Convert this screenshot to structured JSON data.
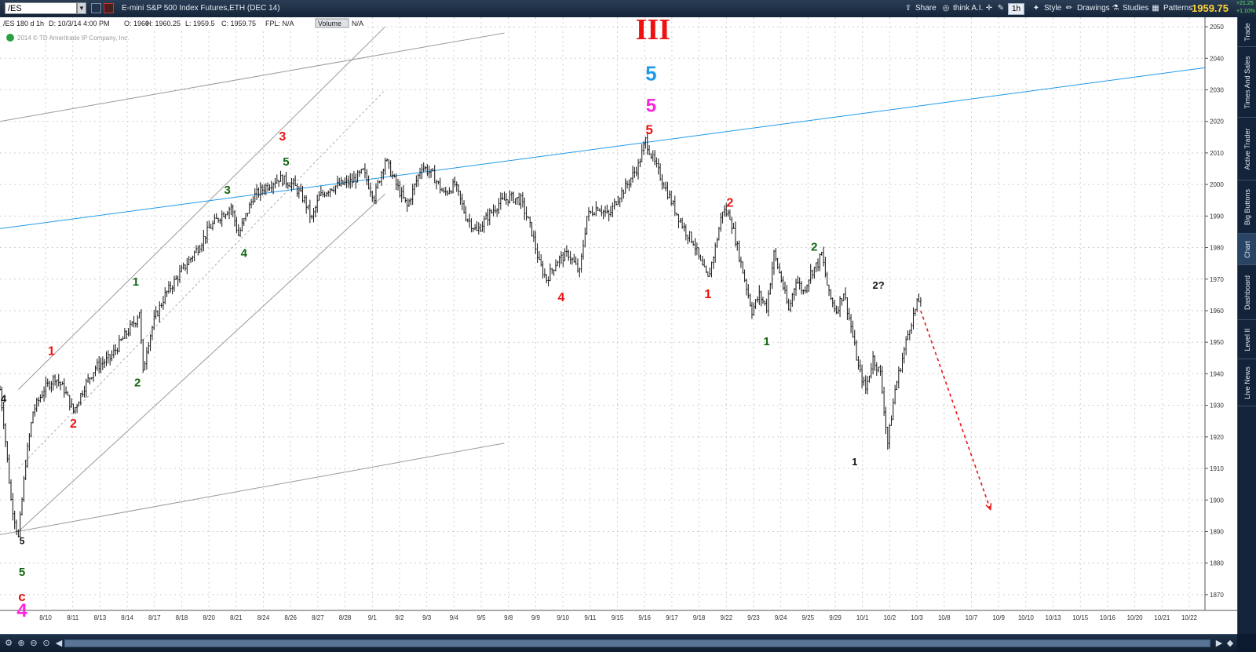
{
  "toolbar": {
    "symbol": "/ES",
    "description": "E-mini S&P 500 Index Futures,ETH (DEC 14)",
    "share": "Share",
    "thinkai": "think A.I.",
    "timeframe": "1h",
    "style": "Style",
    "drawings": "Drawings",
    "studies": "Studies",
    "patterns": "Patterns",
    "last_price": "1959.75",
    "change": "+21.25",
    "change_pct": "+1.10%"
  },
  "side_tabs": [
    "Trade",
    "Times And Sales",
    "Active Trader",
    "Big Buttons",
    "Chart",
    "Dashboard",
    "Level II",
    "Live News"
  ],
  "colors": {
    "red": "#ee1111",
    "green": "#116611",
    "magenta": "#ff22dd",
    "blue": "#1f9ae8",
    "black": "#111111",
    "grey": "#9a9a9a"
  },
  "chart_data": {
    "type": "candlestick",
    "symbol_header": "/ES 180 d 1h",
    "ohlc_header": {
      "date": "D: 10/3/14 4:00 PM",
      "open": "O: 1960",
      "high": "H: 1960.25",
      "low": "L: 1959.5",
      "close": "C: 1959.75",
      "fpl": "FPL: N/A",
      "volume_label": "Volume",
      "volume": "N/A"
    },
    "copyright": "2014 © TD Ameritrade IP Company, Inc.",
    "ylim": [
      1865,
      2053
    ],
    "y_ticks": [
      2050,
      2040,
      2030,
      2020,
      2010,
      2000,
      1990,
      1980,
      1970,
      1960,
      1950,
      1940,
      1930,
      1920,
      1910,
      1900,
      1890,
      1880,
      1870
    ],
    "x_ticks": [
      "8/10",
      "8/11",
      "8/13",
      "8/14",
      "8/17",
      "8/18",
      "8/20",
      "8/21",
      "8/24",
      "8/26",
      "8/27",
      "8/28",
      "9/1",
      "9/2",
      "9/3",
      "9/4",
      "9/5",
      "9/8",
      "9/9",
      "9/10",
      "9/11",
      "9/15",
      "9/16",
      "9/17",
      "9/18",
      "9/22",
      "9/23",
      "9/24",
      "9/25",
      "9/29",
      "10/1",
      "10/2",
      "10/3",
      "10/8",
      "10/7",
      "10/9",
      "10/10",
      "10/13",
      "10/15",
      "10/16",
      "10/20",
      "10/21",
      "10/22"
    ],
    "price_path": [
      [
        0,
        1935
      ],
      [
        2,
        1925
      ],
      [
        6,
        1900
      ],
      [
        10,
        1888
      ],
      [
        14,
        1912
      ],
      [
        18,
        1928
      ],
      [
        24,
        1935
      ],
      [
        30,
        1939
      ],
      [
        35,
        1935
      ],
      [
        40,
        1928
      ],
      [
        46,
        1936
      ],
      [
        52,
        1942
      ],
      [
        60,
        1945
      ],
      [
        68,
        1952
      ],
      [
        74,
        1957
      ],
      [
        76,
        1960
      ],
      [
        78,
        1940
      ],
      [
        80,
        1948
      ],
      [
        84,
        1957
      ],
      [
        90,
        1965
      ],
      [
        96,
        1970
      ],
      [
        102,
        1975
      ],
      [
        108,
        1980
      ],
      [
        114,
        1986
      ],
      [
        120,
        1990
      ],
      [
        126,
        1993
      ],
      [
        130,
        1984
      ],
      [
        134,
        1990
      ],
      [
        138,
        1996
      ],
      [
        144,
        1999
      ],
      [
        152,
        2002
      ],
      [
        160,
        2000
      ],
      [
        166,
        1995
      ],
      [
        170,
        1989
      ],
      [
        174,
        1996
      ],
      [
        180,
        1999
      ],
      [
        186,
        2000
      ],
      [
        192,
        2001
      ],
      [
        198,
        2004
      ],
      [
        204,
        1996
      ],
      [
        210,
        2008
      ],
      [
        216,
        2000
      ],
      [
        222,
        1993
      ],
      [
        230,
        2006
      ],
      [
        236,
        2003
      ],
      [
        242,
        1997
      ],
      [
        248,
        2000
      ],
      [
        254,
        1990
      ],
      [
        260,
        1985
      ],
      [
        266,
        1990
      ],
      [
        272,
        1994
      ],
      [
        278,
        1996
      ],
      [
        284,
        1995
      ],
      [
        290,
        1985
      ],
      [
        294,
        1975
      ],
      [
        298,
        1970
      ],
      [
        304,
        1976
      ],
      [
        310,
        1978
      ],
      [
        316,
        1972
      ],
      [
        320,
        1990
      ],
      [
        326,
        1993
      ],
      [
        332,
        1990
      ],
      [
        336,
        1995
      ],
      [
        342,
        2000
      ],
      [
        348,
        2006
      ],
      [
        352,
        2014
      ],
      [
        356,
        2008
      ],
      [
        362,
        2000
      ],
      [
        368,
        1992
      ],
      [
        374,
        1985
      ],
      [
        378,
        1982
      ],
      [
        382,
        1975
      ],
      [
        386,
        1970
      ],
      [
        390,
        1980
      ],
      [
        394,
        1992
      ],
      [
        398,
        1990
      ],
      [
        402,
        1980
      ],
      [
        406,
        1970
      ],
      [
        410,
        1960
      ],
      [
        414,
        1965
      ],
      [
        418,
        1961
      ],
      [
        422,
        1978
      ],
      [
        426,
        1970
      ],
      [
        430,
        1960
      ],
      [
        434,
        1970
      ],
      [
        438,
        1966
      ],
      [
        442,
        1972
      ],
      [
        446,
        1975
      ],
      [
        448,
        1978
      ],
      [
        452,
        1965
      ],
      [
        456,
        1960
      ],
      [
        460,
        1966
      ],
      [
        464,
        1955
      ],
      [
        468,
        1942
      ],
      [
        472,
        1935
      ],
      [
        476,
        1945
      ],
      [
        480,
        1940
      ],
      [
        484,
        1918
      ],
      [
        488,
        1935
      ],
      [
        492,
        1945
      ],
      [
        496,
        1955
      ],
      [
        500,
        1962
      ],
      [
        502,
        1964
      ]
    ],
    "trendlines": [
      {
        "color": "#9a9a9a",
        "dash": false,
        "from": [
          0,
          2020
        ],
        "to": [
          275,
          2048
        ]
      },
      {
        "color": "#9a9a9a",
        "dash": false,
        "from": [
          0,
          1889
        ],
        "to": [
          275,
          1918
        ]
      },
      {
        "color": "#9a9a9a",
        "dash": false,
        "from": [
          10,
          1890
        ],
        "to": [
          210,
          1997
        ]
      },
      {
        "color": "#9a9a9a",
        "dash": false,
        "from": [
          10,
          1935
        ],
        "to": [
          210,
          2050
        ]
      },
      {
        "color": "#b0b0b0",
        "dash": true,
        "from": [
          10,
          1910
        ],
        "to": [
          210,
          2030
        ]
      },
      {
        "color": "#1f9ae8",
        "dash": false,
        "from": [
          0,
          1986
        ],
        "to": [
          657,
          2037
        ]
      },
      {
        "color": "#ee1111",
        "dash": true,
        "arrow": true,
        "from": [
          502,
          1960
        ],
        "to": [
          540,
          1897
        ]
      }
    ],
    "annotations": [
      {
        "text": "4",
        "color": "black",
        "size": 13,
        "at": [
          2,
          1931
        ]
      },
      {
        "text": "1",
        "color": "red",
        "size": 16,
        "at": [
          28,
          1946
        ]
      },
      {
        "text": "2",
        "color": "red",
        "size": 16,
        "at": [
          40,
          1923
        ]
      },
      {
        "text": "5",
        "color": "black",
        "size": 12,
        "at": [
          12,
          1886
        ]
      },
      {
        "text": "5",
        "color": "green",
        "size": 15,
        "at": [
          12,
          1876
        ]
      },
      {
        "text": "c",
        "color": "red",
        "size": 17,
        "at": [
          12,
          1868
        ]
      },
      {
        "text": "4",
        "color": "magenta",
        "size": 24,
        "at": [
          12,
          1863
        ]
      },
      {
        "text": "1",
        "color": "green",
        "size": 15,
        "at": [
          74,
          1968
        ]
      },
      {
        "text": "2",
        "color": "green",
        "size": 15,
        "at": [
          75,
          1936
        ]
      },
      {
        "text": "3",
        "color": "green",
        "size": 15,
        "at": [
          124,
          1997
        ]
      },
      {
        "text": "4",
        "color": "green",
        "size": 15,
        "at": [
          133,
          1977
        ]
      },
      {
        "text": "5",
        "color": "green",
        "size": 15,
        "at": [
          156,
          2006
        ]
      },
      {
        "text": "3",
        "color": "red",
        "size": 16,
        "at": [
          154,
          2014
        ]
      },
      {
        "text": "III",
        "color": "red",
        "size": 38,
        "at": [
          356,
          2046
        ]
      },
      {
        "text": "5",
        "color": "blue",
        "size": 26,
        "at": [
          355,
          2033
        ]
      },
      {
        "text": "5",
        "color": "magenta",
        "size": 24,
        "at": [
          355,
          2023
        ]
      },
      {
        "text": "5",
        "color": "red",
        "size": 17,
        "at": [
          354,
          2016
        ]
      },
      {
        "text": "4",
        "color": "red",
        "size": 16,
        "at": [
          306,
          1963
        ]
      },
      {
        "text": "1",
        "color": "red",
        "size": 16,
        "at": [
          386,
          1964
        ]
      },
      {
        "text": "2",
        "color": "red",
        "size": 16,
        "at": [
          398,
          1993
        ]
      },
      {
        "text": "1",
        "color": "green",
        "size": 15,
        "at": [
          418,
          1949
        ]
      },
      {
        "text": "2",
        "color": "green",
        "size": 15,
        "at": [
          444,
          1979
        ]
      },
      {
        "text": "1",
        "color": "black",
        "size": 13,
        "at": [
          466,
          1911
        ]
      },
      {
        "text": "2?",
        "color": "black",
        "size": 13,
        "at": [
          479,
          1967
        ]
      }
    ]
  }
}
